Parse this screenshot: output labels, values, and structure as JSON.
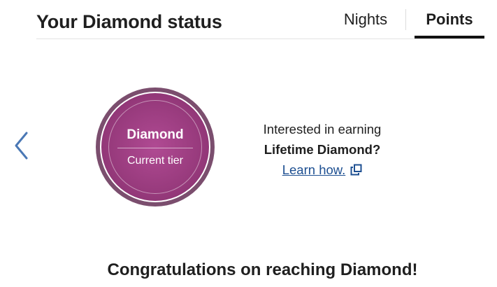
{
  "header": {
    "title": "Your Diamond status",
    "tabs": [
      {
        "label": "Nights",
        "selected": false
      },
      {
        "label": "Points",
        "selected": true
      }
    ]
  },
  "badge": {
    "tier": "Diamond",
    "subtitle": "Current tier",
    "color": "#973a7c",
    "ring_color": "#7b4e6e"
  },
  "promo": {
    "line1": "Interested in earning",
    "line2": "Lifetime Diamond?",
    "link_label": "Learn how.",
    "link_color": "#1d4f91",
    "link_icon": "external-link-icon"
  },
  "navigation": {
    "prev_icon": "chevron-left-icon"
  },
  "footer": {
    "congrats": "Congratulations on reaching Diamond!"
  }
}
